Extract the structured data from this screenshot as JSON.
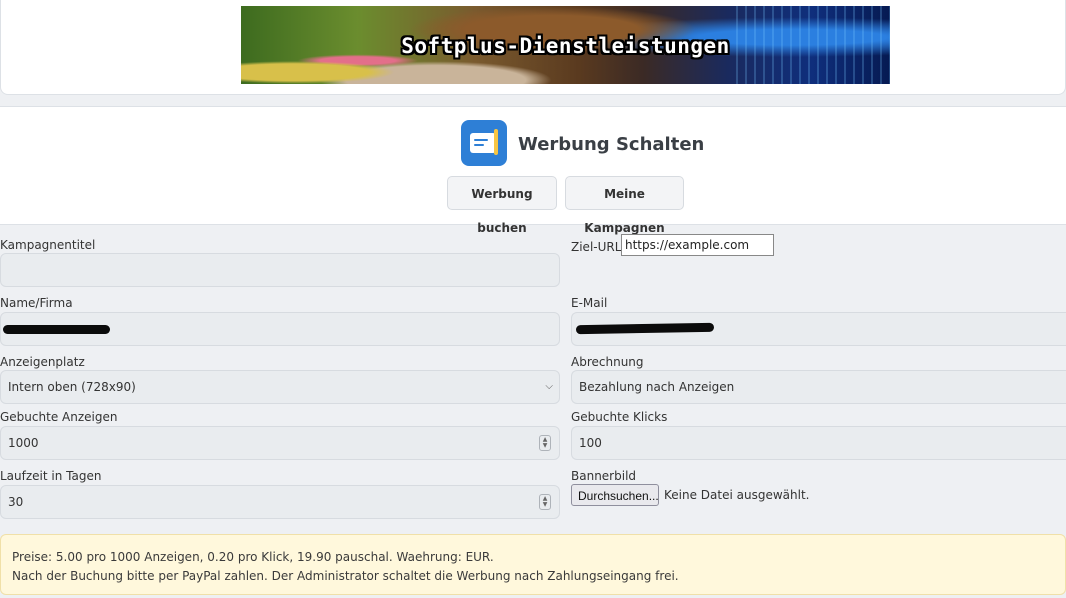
{
  "banner": {
    "text": "Softplus-Dienstleistungen"
  },
  "header": {
    "title": "Werbung Schalten",
    "tabs": [
      {
        "label": "Werbung buchen"
      },
      {
        "label": "Meine Kampagnen"
      }
    ],
    "icon": "document-pen-icon",
    "accent": "#2e7fd6"
  },
  "form": {
    "campaign_title": {
      "label": "Kampagnentitel",
      "value": ""
    },
    "target_url": {
      "label": "Ziel-URL",
      "placeholder": "https://example.com"
    },
    "name": {
      "label": "Name/Firma",
      "value": ""
    },
    "email": {
      "label": "E-Mail",
      "value": ""
    },
    "slot": {
      "label": "Anzeigenplatz",
      "value": "Intern oben (728x90)"
    },
    "billing": {
      "label": "Abrechnung",
      "value": "Bezahlung nach Anzeigen"
    },
    "impressions": {
      "label": "Gebuchte Anzeigen",
      "value": "1000"
    },
    "clicks": {
      "label": "Gebuchte Klicks",
      "value": "100"
    },
    "days": {
      "label": "Laufzeit in Tagen",
      "value": "30"
    },
    "banner_image": {
      "label": "Bannerbild",
      "button": "Durchsuchen...",
      "status": "Keine Datei ausgewählt."
    }
  },
  "info": {
    "line1": "Preise: 5.00 pro 1000 Anzeigen, 0.20 pro Klick, 19.90 pauschal. Waehrung: EUR.",
    "line2": "Nach der Buchung bitte per PayPal zahlen. Der Administrator schaltet die Werbung nach Zahlungseingang frei."
  }
}
